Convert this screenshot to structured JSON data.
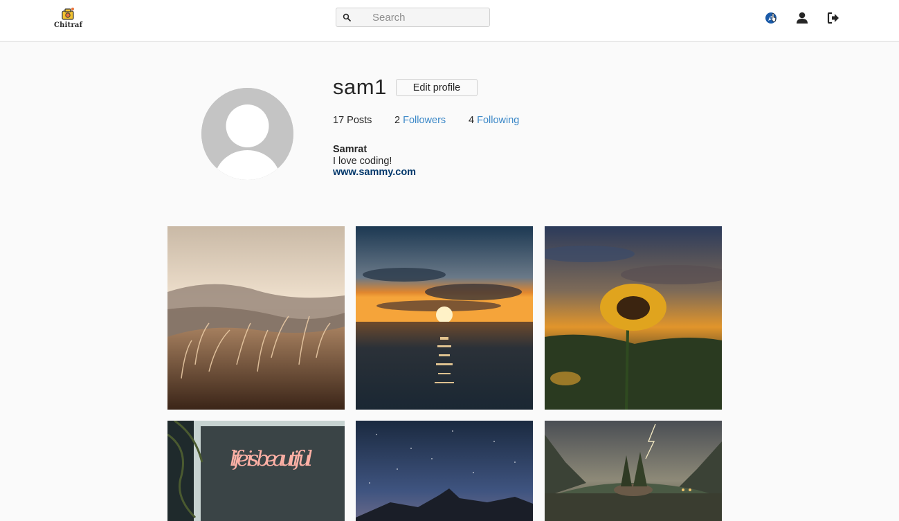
{
  "header": {
    "logo_text": "Chitraf",
    "search": {
      "placeholder": "Search",
      "value": ""
    },
    "nav_icons": [
      "compass-icon",
      "user-icon",
      "logout-icon"
    ]
  },
  "profile": {
    "username": "sam1",
    "edit_label": "Edit profile",
    "posts_count": "17",
    "posts_label": "Posts",
    "followers_count": "2",
    "followers_label": "Followers",
    "following_count": "4",
    "following_label": "Following",
    "full_name": "Samrat",
    "bio": "I love coding!",
    "website": "www.sammy.com"
  },
  "posts": [
    {
      "subject": "grass field at sunset over hills"
    },
    {
      "subject": "sun setting over the sea"
    },
    {
      "subject": "sunflower at dusk"
    },
    {
      "subject": "neon sign 'life is beautiful'",
      "neon_text": "life is beautiful"
    },
    {
      "subject": "starry night over mountain ridge"
    },
    {
      "subject": "lake with tree island and lightning"
    }
  ],
  "colors": {
    "accent_link": "#3a87c7",
    "website_link": "#00376b",
    "background": "#fafafa"
  }
}
